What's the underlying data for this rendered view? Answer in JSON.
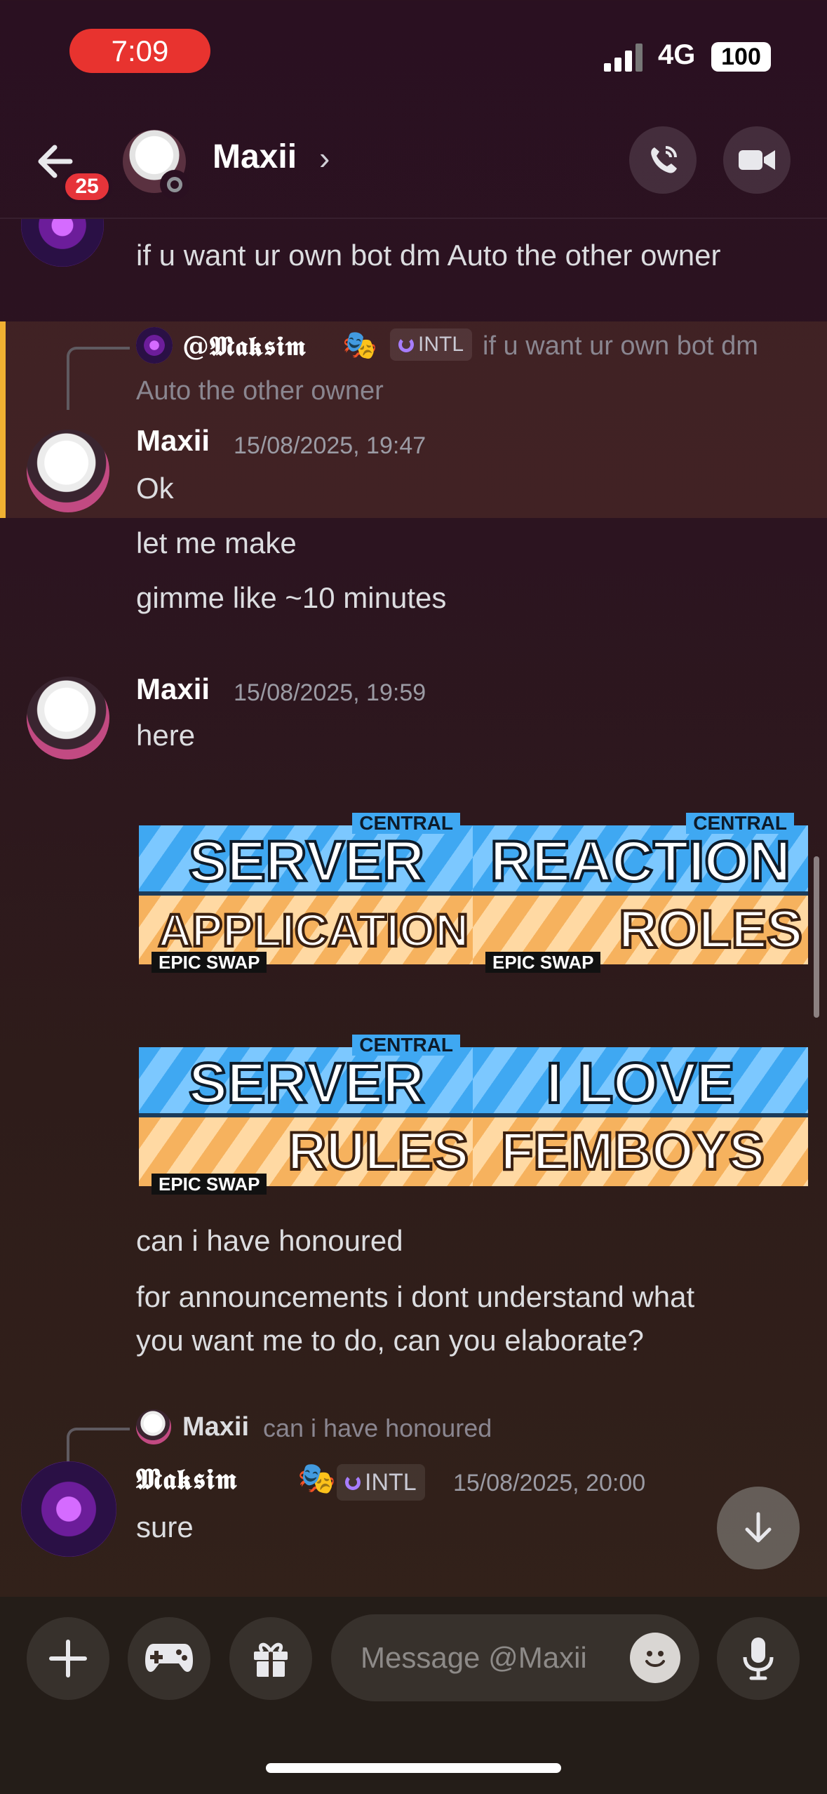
{
  "status_bar": {
    "time": "7:09",
    "network": "4G",
    "battery": "100"
  },
  "header": {
    "badge": "25",
    "title": "Maxii",
    "chevron": "›"
  },
  "messages": {
    "partial_top": {
      "text": "if u want ur own bot dm Auto the other owner"
    },
    "reply1": {
      "ref_user": "@𝕸𝖆𝖐𝖘𝖎𝖒",
      "ref_tag": "INTL",
      "ref_text_line1": "if u want ur own bot dm",
      "ref_text_line2": "Auto the other owner"
    },
    "group1": {
      "user": "Maxii",
      "time": "15/08/2025, 19:47",
      "lines": [
        "Ok",
        "let me make",
        "gimme like ~10 minutes"
      ]
    },
    "group2": {
      "user": "Maxii",
      "time": "15/08/2025, 19:59",
      "text": "here",
      "stickers": [
        {
          "top": "SERVER",
          "bottom": "APPLICATION",
          "brand": "CENTRAL",
          "footer": "EPIC SWAP"
        },
        {
          "top": "REACTION",
          "bottom": "ROLES",
          "brand": "CENTRAL",
          "footer": "EPIC SWAP"
        },
        {
          "top": "SERVER",
          "bottom": "RULES",
          "brand": "CENTRAL",
          "footer": "EPIC SWAP"
        },
        {
          "top": "I LOVE",
          "bottom": "FEMBOYS",
          "brand": "",
          "footer": ""
        }
      ],
      "after_lines": [
        "can i have honoured",
        "for announcements i dont understand what",
        "you want me to do, can you elaborate?"
      ]
    },
    "reply2": {
      "ref_user": "Maxii",
      "ref_text": "can i have honoured"
    },
    "group3": {
      "user": "𝕸𝖆𝖐𝖘𝖎𝖒",
      "tag": "INTL",
      "time": "15/08/2025, 20:00",
      "text": "sure"
    }
  },
  "composer": {
    "placeholder": "Message @Maxii"
  },
  "colors": {
    "accent": "#f0b132",
    "badge": "#e6343a",
    "time_pill": "#e8332f"
  }
}
